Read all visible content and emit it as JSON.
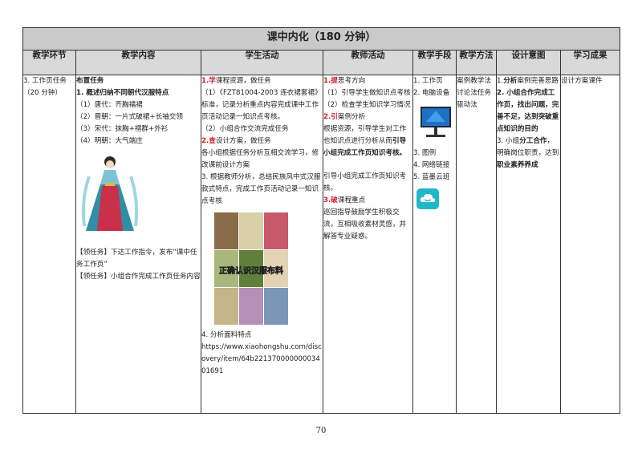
{
  "section_title": "课中内化（180 分钟）",
  "headers": [
    "教学环节",
    "教学内容",
    "学生活动",
    "教师活动",
    "教学手段",
    "教学方法",
    "设计意图",
    "学习成果"
  ],
  "stage": "3. 工作页任务（20 分钟）",
  "content": {
    "heading": "布置任务",
    "subheading": "1. 概述归纳不同朝代汉服特点",
    "items": [
      "（1）唐代：齐胸襦裙",
      "（2）晋朝：一片式破裙+长袖交领",
      "（3）宋代：抹胸+褶群+外衫",
      "（4）明朝：大气端庄"
    ],
    "task1": "【领任务】下达工作指令，发布“课中任务工作页”",
    "task2": "【领任务】小组合作完成工作页任务内容"
  },
  "student": {
    "s1_num": "1.",
    "s1_key": "学",
    "s1_rest": "课程资源，做任务",
    "s1_text": "（1）《FZT81004-2003 连衣裙套裙》标准，记录分析重点内容完成课中工作页活动记录一知识点考核。",
    "s1_text2": "（2）小组合作交流完成任务",
    "s2_num": "2.",
    "s2_key": "查",
    "s2_rest": "设计方案，做任务",
    "s2_text": "各小组根据任务分析互相交流学习，修改课前设计方案",
    "s3_text": "3. 根据教师分析，总结民族风中式汉服款式特点，完成工作页活动记录一知识点考核",
    "fabric_caption": "正确认识汉服布料",
    "s4_text": "4.  分析面料特点",
    "url": "https://www.xiaohongshu.com/discovery/item/64b22137000000003401691"
  },
  "teacher": {
    "t1_num": "1.",
    "t1_key": "提",
    "t1_rest": "思考方向",
    "t1_a": "（1）引导学生做知识点考核",
    "t1_b": "（2）检查学生知识学习情况",
    "t2_num": "2.",
    "t2_key": "引",
    "t2_rest": "案例分析",
    "t2_text": "根据资源，引导学生对工作也知识点进行分析从而",
    "t2_bold": "引导小组完成工作页知识考核。",
    "t2_extra": "引导小组完成工作页知识考核。",
    "t3_num": "3.",
    "t3_key": "破",
    "t3_rest": "课程重点",
    "t3_text": "巡回指导鼓励学生积极交流，互相吸收素材灵感，并解答专业疑惑。"
  },
  "means": [
    "1. 工作页",
    "2. 电脑设备",
    "3. 图例",
    "4. 网络链接",
    "5. 蓝墨云班"
  ],
  "methods": "案例教学法讨论法任务驱动法",
  "intent": {
    "i1_num": "1.",
    "i1_bold": "分析",
    "i1_rest": "案例完善思路",
    "i2": "2. 小组合作完成工作页，找出问题，完善不足，达到突破重点知识的目的",
    "i3_pre": "3. 小组",
    "i3_bold": "分工合作",
    "i3_mid": "，明确岗位职责，达到",
    "i3_bold2": "职业素养养成"
  },
  "outcome": "设计方案课件",
  "page_number": "70",
  "colors": {
    "header_bg": "#d9d9d9",
    "title_bg": "#c9c9c9",
    "accent_red": "#d0202a"
  }
}
